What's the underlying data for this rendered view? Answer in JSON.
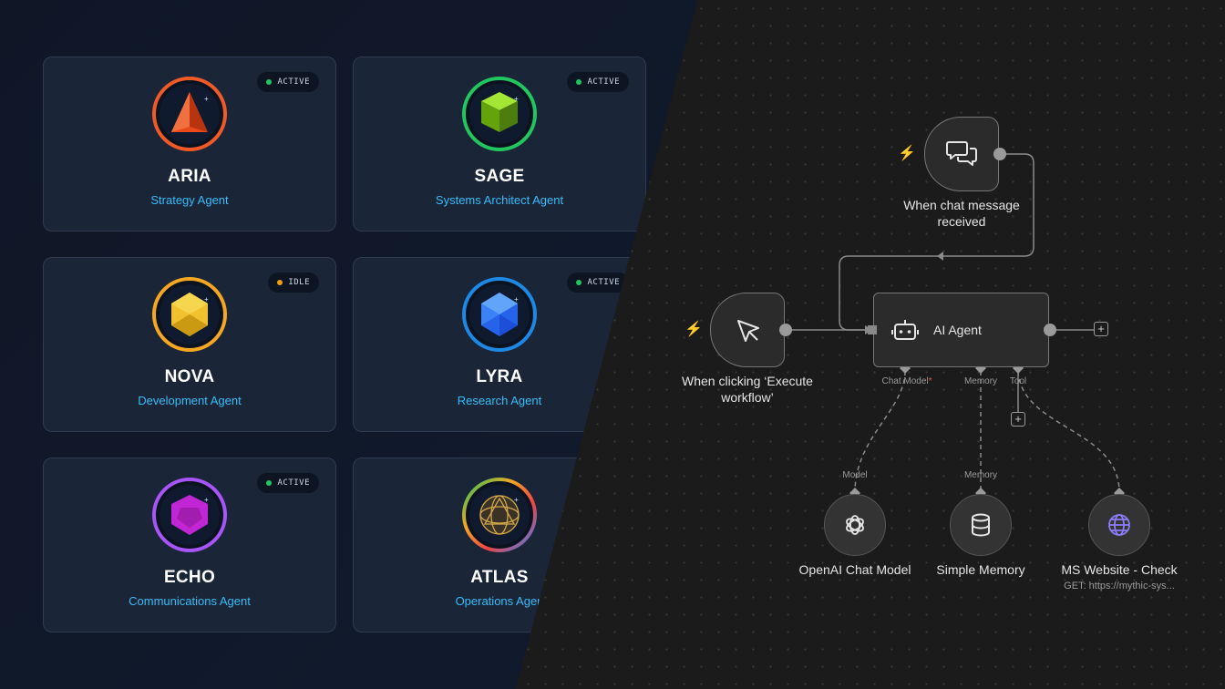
{
  "agents": [
    {
      "name": "ARIA",
      "role": "Strategy Agent",
      "status": "ACTIVE",
      "ring": "#f05a28",
      "gem": "pyramid",
      "gem_color": "#e84a1c",
      "icon": "pyramid-gem-icon"
    },
    {
      "name": "SAGE",
      "role": "Systems Architect Agent",
      "status": "ACTIVE",
      "ring": "#22c55e",
      "gem": "cube",
      "gem_color": "#7ccc1a",
      "icon": "cube-gem-icon"
    },
    {
      "name": "NOVA",
      "role": "Development Agent",
      "status": "IDLE",
      "ring": "#f5a623",
      "gem": "hexagon",
      "gem_color": "#f2c12e",
      "icon": "hexagon-gem-icon"
    },
    {
      "name": "LYRA",
      "role": "Research Agent",
      "status": "ACTIVE",
      "ring": "#1e88e5",
      "gem": "icosa",
      "gem_color": "#3b82f6",
      "icon": "icosahedron-gem-icon"
    },
    {
      "name": "ECHO",
      "role": "Communications Agent",
      "status": "ACTIVE",
      "ring": "#a855f7",
      "gem": "dodeca",
      "gem_color": "#c026d3",
      "icon": "dodecahedron-gem-icon"
    },
    {
      "name": "ATLAS",
      "role": "Operations Agen",
      "status": "",
      "ring": "#22c55e",
      "gem": "sphere",
      "gem_color": "#d4a84a",
      "icon": "geodesic-sphere-icon"
    }
  ],
  "workflow": {
    "chat_trigger_label_1": "When chat message",
    "chat_trigger_label_2": "received",
    "manual_trigger_label_1": "When clicking ‘Execute",
    "manual_trigger_label_2": "workflow’",
    "agent_title": "AI Agent",
    "port_chat_model": "Chat Model",
    "port_chat_model_required": "*",
    "port_memory": "Memory",
    "port_tool": "Tool",
    "sub_model_port": "Model",
    "sub_memory_port": "Memory",
    "openai_label": "OpenAI Chat Model",
    "memory_label": "Simple Memory",
    "website_label": "MS Website - Check",
    "website_sub": "GET: https://mythic-sys..."
  },
  "colors": {
    "trigger_bolt": "#e85d4a",
    "accent_cyan": "#38bdf8",
    "required_star": "#e85d4a"
  }
}
